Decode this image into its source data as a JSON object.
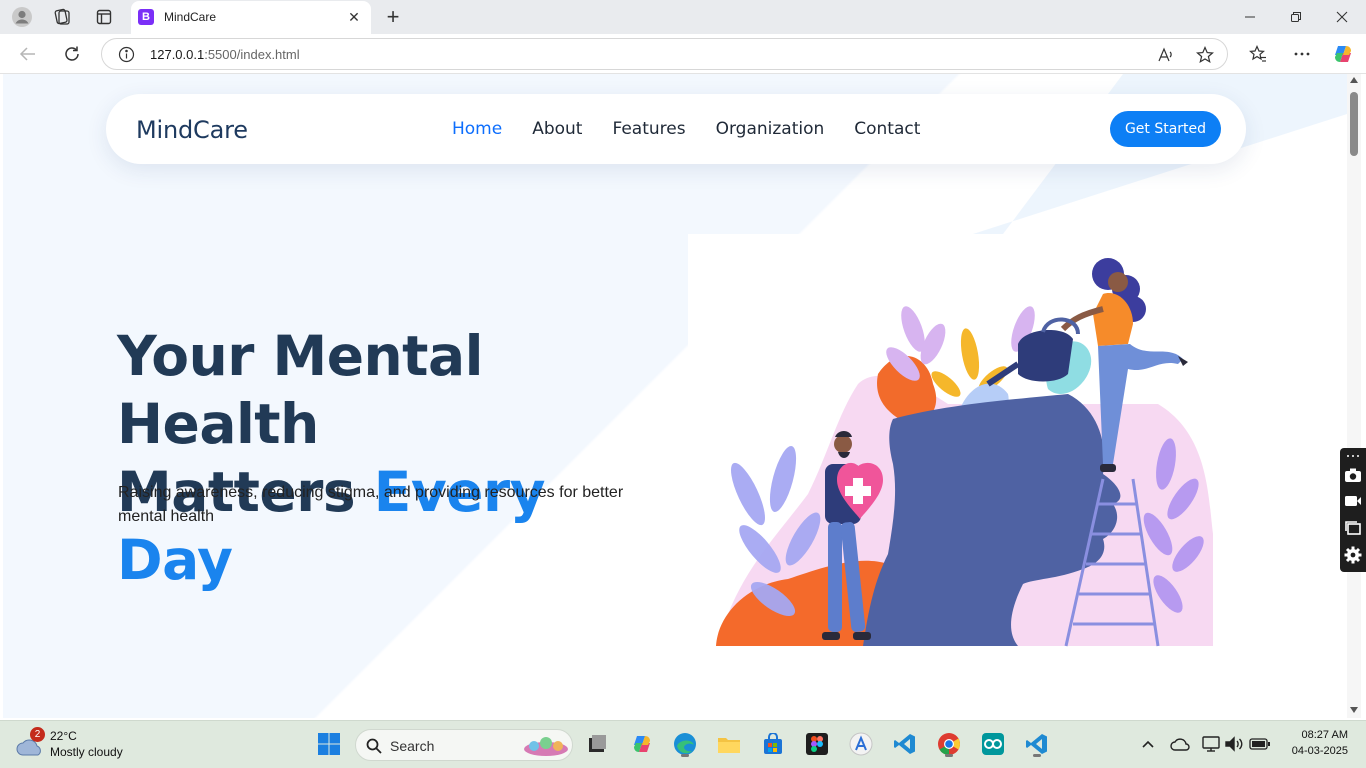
{
  "browser": {
    "tab_title": "MindCare",
    "tab_favicon_letter": "B",
    "address_host": "127.0.0.1",
    "address_path": ":5500/index.html"
  },
  "site": {
    "brand": "MindCare",
    "nav": [
      {
        "label": "Home",
        "active": true
      },
      {
        "label": "About",
        "active": false
      },
      {
        "label": "Features",
        "active": false
      },
      {
        "label": "Organization",
        "active": false
      },
      {
        "label": "Contact",
        "active": false
      }
    ],
    "cta_label": "Get Started",
    "hero_title_line1": "Your Mental Health",
    "hero_title_line2_plain": "Matters ",
    "hero_title_line2_accent": "Every Day",
    "hero_subtitle": "Raising awareness, reducing stigma, and providing resources for better mental health"
  },
  "taskbar": {
    "weather_temp": "22°C",
    "weather_desc": "Mostly cloudy",
    "weather_badge": "2",
    "search_label": "Search",
    "time": "08:27 AM",
    "date": "04-03-2025"
  },
  "colors": {
    "accent": "#0d7ff5",
    "heading": "#213a56",
    "nav_active": "#0d6efd"
  }
}
